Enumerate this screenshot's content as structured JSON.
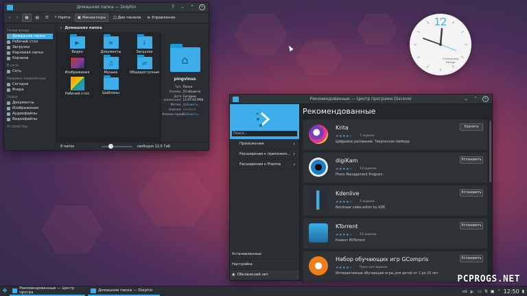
{
  "dolphin": {
    "title": "Домашняя папка — Dolphin",
    "toolbar": {
      "find": "Найти",
      "thumbnails": "Миниатюры",
      "split": "Две панели",
      "control": "Управление"
    },
    "places": [
      {
        "section": "Точки входа",
        "items": [
          "Домашняя папка",
          "Рабочий стол",
          "Загрузки",
          "Корневая папка",
          "Корзина"
        ]
      },
      {
        "section": "В сети",
        "items": [
          "Сеть"
        ]
      },
      {
        "section": "Недавно изменённые",
        "items": [
          "Сегодня",
          "Вчера"
        ]
      },
      {
        "section": "Поиск",
        "items": [
          "Документы",
          "Изображения",
          "Аудиофайлы",
          "Видеофайлы"
        ]
      },
      {
        "section": "Устройства",
        "items": []
      }
    ],
    "breadcrumb": "Домашняя папка",
    "files": [
      {
        "name": "Видео",
        "symbol": "▶"
      },
      {
        "name": "Документы",
        "symbol": "≡"
      },
      {
        "name": "Загрузки",
        "symbol": "↓"
      },
      {
        "name": "Изображения",
        "symbol": "▦"
      },
      {
        "name": "Музыка",
        "symbol": "♫"
      },
      {
        "name": "Общедоступные",
        "symbol": "⇄"
      },
      {
        "name": "Рабочий стол",
        "symbol": ""
      },
      {
        "name": "Шаблоны",
        "symbol": ""
      }
    ],
    "info": {
      "name": "pingvinus",
      "type_k": "Тип:",
      "type_v": "Папка",
      "size_k": "Размер:",
      "size_v": "23 объекта",
      "date_k": "Дата изменения:",
      "date_v": "Сегодня, 11:07:01 MSK",
      "tags_k": "Метки:",
      "tags_v": "Добавить...",
      "rating_k": "Оценка:",
      "rating_v": "☆☆☆☆☆",
      "comment_k": "Комментарий:",
      "comment_v": "Добавить..."
    },
    "status": {
      "count": "8 папок",
      "free": "свободно 12,5 ГиБ"
    }
  },
  "discover": {
    "title": "Рекомендованные — Центр программ Discover",
    "search_placeholder": "Поиск...",
    "nav": [
      "Приложения",
      "Расширения к приложен...",
      "Расширения к Plasma"
    ],
    "nav_bottom": [
      "Установленные",
      "Настройка",
      "Обновлений нет"
    ],
    "heading": "Рекомендованные",
    "apps": [
      {
        "name": "Krita",
        "stars": 4,
        "reviews": "7 оценок",
        "desc": "Цифровое рисование. Творческая свобода",
        "button": "Удалить"
      },
      {
        "name": "digiKam",
        "stars": 4,
        "reviews": "13 оценок",
        "desc": "Photo Management Program",
        "button": "Установить"
      },
      {
        "name": "Kdenlive",
        "stars": 4,
        "reviews": "5 оценок",
        "desc": "Nonlinear video editor by KDE",
        "button": "Установить"
      },
      {
        "name": "KTorrent",
        "stars": 4,
        "reviews": "12 оценок",
        "desc": "Клиент BitTorrent",
        "button": "Установить"
      },
      {
        "name": "Набор обучающих игр GCompris",
        "stars": 4,
        "reviews": "Пока нет оценок",
        "desc": "Интерактивные обучающие игры для детей от 2 до 10 лет",
        "button": "Установить"
      }
    ]
  },
  "clock": {
    "numeral": "12",
    "brand1": "Community",
    "brand2": "Design"
  },
  "taskbar": {
    "tasks": [
      "Рекомендованные — Центр програ",
      "Домашняя папка — Dolphin"
    ],
    "lang": "us",
    "time": "12:50"
  },
  "watermark": "PCPROGS.NET",
  "colors": {
    "accent": "#3daee9",
    "window_bg": "#2a2e32",
    "titlebar": "#31363b"
  }
}
